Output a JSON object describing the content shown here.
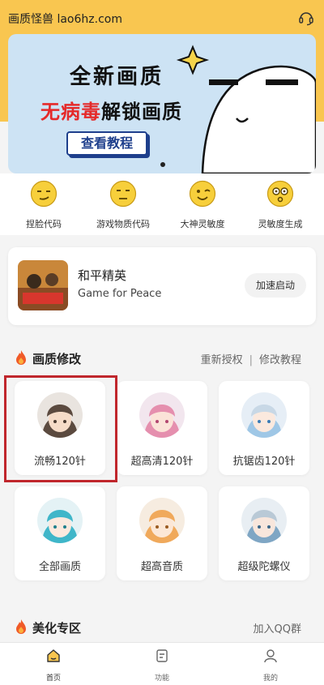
{
  "app": {
    "title": "画质怪兽 lao6hz.com"
  },
  "banner": {
    "line1": "全新画质",
    "line2_red": "无病毒",
    "line2_black": "解锁画质",
    "button": "查看教程"
  },
  "quick": [
    {
      "label": "捏脸代码",
      "icon": "smirk-face-icon"
    },
    {
      "label": "游戏物质代码",
      "icon": "neutral-face-icon"
    },
    {
      "label": "大神灵敏度",
      "icon": "wink-face-icon"
    },
    {
      "label": "灵敏度生成",
      "icon": "dizzy-face-icon"
    }
  ],
  "game": {
    "name": "和平精英",
    "subtitle": "Game for Peace",
    "action": "加速启动"
  },
  "quality_section": {
    "title": "画质修改",
    "link1": "重新授权",
    "separator": "|",
    "link2": "修改教程",
    "tiles": [
      {
        "label": "流畅120针",
        "color": "#5b4a3f"
      },
      {
        "label": "超高清120针",
        "color": "#e58fae"
      },
      {
        "label": "抗锯齿120针",
        "color": "#9fc7e6"
      },
      {
        "label": "全部画质",
        "color": "#3fb6c9"
      },
      {
        "label": "超高音质",
        "color": "#f0a95b"
      },
      {
        "label": "超级陀螺仪",
        "color": "#7fa6c4"
      }
    ]
  },
  "beauty_section": {
    "title": "美化专区",
    "link": "加入QQ群"
  },
  "nav": [
    {
      "label": "首页",
      "icon": "home-icon"
    },
    {
      "label": "功能",
      "icon": "function-icon"
    },
    {
      "label": "我的",
      "icon": "profile-icon"
    }
  ],
  "colors": {
    "accent": "#f9c650",
    "highlight_border": "#c0262c",
    "banner_bg": "#cde3f4"
  }
}
